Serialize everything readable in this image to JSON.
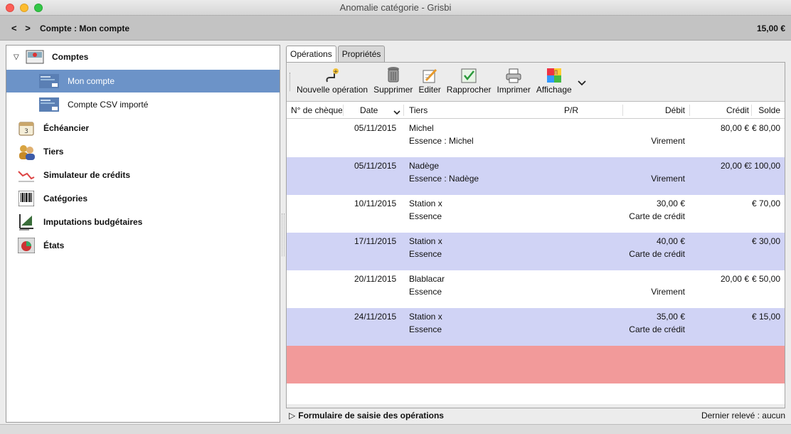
{
  "window": {
    "title": "Anomalie catégorie - Grisbi"
  },
  "pathbar": {
    "back": "<",
    "forward": ">",
    "account": "Compte : Mon compte",
    "balance": "15,00 €"
  },
  "sidebar": {
    "items": [
      {
        "label": "Comptes",
        "icon": "accounts-icon"
      },
      {
        "label": "Mon compte",
        "icon": "account-card-icon"
      },
      {
        "label": "Compte CSV importé",
        "icon": "account-card-icon"
      },
      {
        "label": "Échéancier",
        "icon": "calendar-icon"
      },
      {
        "label": "Tiers",
        "icon": "people-icon"
      },
      {
        "label": "Simulateur de crédits",
        "icon": "chart-icon"
      },
      {
        "label": "Catégories",
        "icon": "barcode-icon"
      },
      {
        "label": "Imputations budgétaires",
        "icon": "budget-icon"
      },
      {
        "label": "États",
        "icon": "report-icon"
      }
    ]
  },
  "tabs": [
    {
      "label": "Opérations"
    },
    {
      "label": "Propriétés"
    }
  ],
  "toolbar": {
    "new": "Nouvelle opération",
    "delete": "Supprimer",
    "edit": "Editer",
    "reconcile": "Rapprocher",
    "print": "Imprimer",
    "display": "Affichage"
  },
  "table": {
    "headers": {
      "cheque": "N° de chèque",
      "date": "Date",
      "tiers": "Tiers",
      "pr": "P/R",
      "debit": "Débit",
      "credit": "Crédit",
      "solde": "Solde"
    },
    "rows": [
      {
        "date": "05/11/2015",
        "tiers": "Michel",
        "detail": "Essence : Michel",
        "debit": "",
        "mode": "Virement",
        "credit": "80,00 €",
        "solde": "80,00 €"
      },
      {
        "date": "05/11/2015",
        "tiers": "Nadège",
        "detail": "Essence : Nadège",
        "debit": "",
        "mode": "Virement",
        "credit": "20,00 €",
        "solde": "100,00 €"
      },
      {
        "date": "10/11/2015",
        "tiers": "Station x",
        "detail": "Essence",
        "debit": "30,00 €",
        "mode": "Carte de crédit",
        "credit": "",
        "solde": "70,00 €"
      },
      {
        "date": "17/11/2015",
        "tiers": "Station x",
        "detail": "Essence",
        "debit": "40,00 €",
        "mode": "Carte de crédit",
        "credit": "",
        "solde": "30,00 €"
      },
      {
        "date": "20/11/2015",
        "tiers": "Blablacar",
        "detail": "Essence",
        "debit": "",
        "mode": "Virement",
        "credit": "20,00 €",
        "solde": "50,00 €"
      },
      {
        "date": "24/11/2015",
        "tiers": "Station x",
        "detail": "Essence",
        "debit": "35,00 €",
        "mode": "Carte de crédit",
        "credit": "",
        "solde": "15,00 €"
      }
    ]
  },
  "form": {
    "label": "Formulaire de saisie des opérations",
    "last_statement": "Dernier relevé : aucun"
  }
}
